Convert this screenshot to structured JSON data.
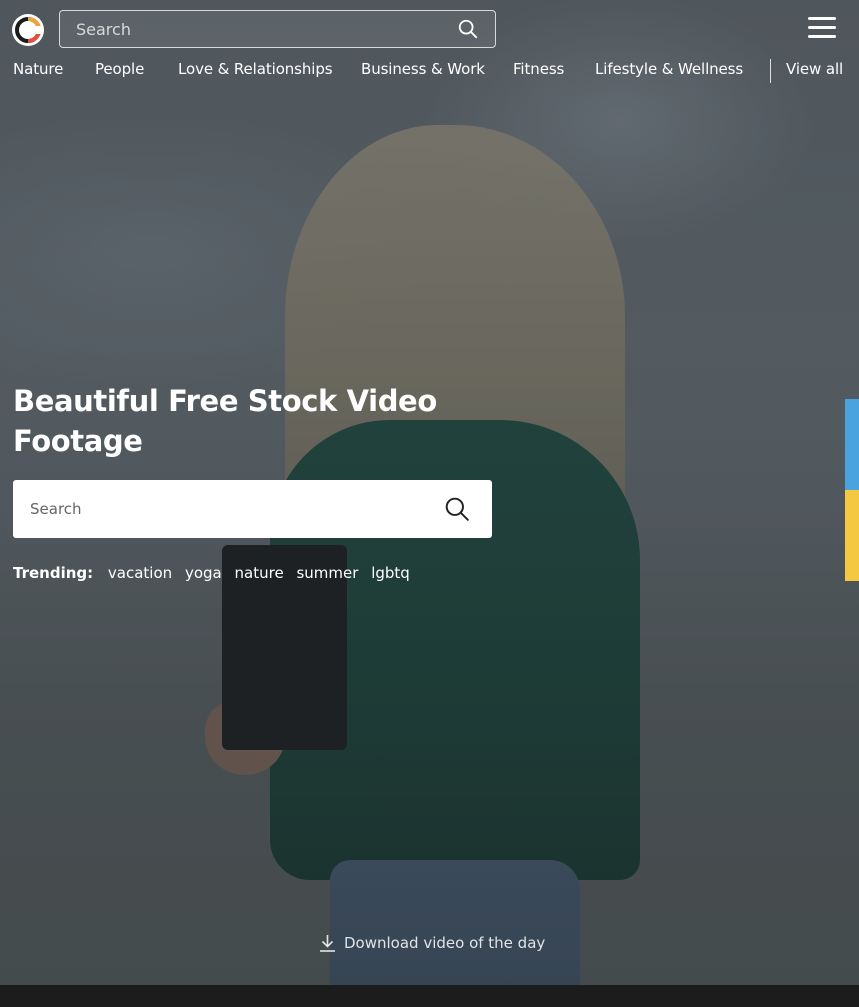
{
  "header": {
    "search_placeholder": "Search",
    "nav_items": [
      {
        "label": "Nature"
      },
      {
        "label": "People"
      },
      {
        "label": "Love & Relationships"
      },
      {
        "label": "Business & Work"
      },
      {
        "label": "Fitness"
      },
      {
        "label": "Lifestyle & Wellness"
      },
      {
        "label": "View all"
      }
    ]
  },
  "hero": {
    "title": "Beautiful Free Stock Video Footage",
    "search_placeholder": "Search",
    "trending_label": "Trending:",
    "trending_tags": [
      "vacation",
      "yoga",
      "nature",
      "summer",
      "lgbtq"
    ],
    "download_label": "Download video of the day"
  },
  "colors": {
    "side_tab_blue": "#4aa3df",
    "side_tab_yellow": "#f5c842",
    "logo_accent": "#f2a23a"
  }
}
